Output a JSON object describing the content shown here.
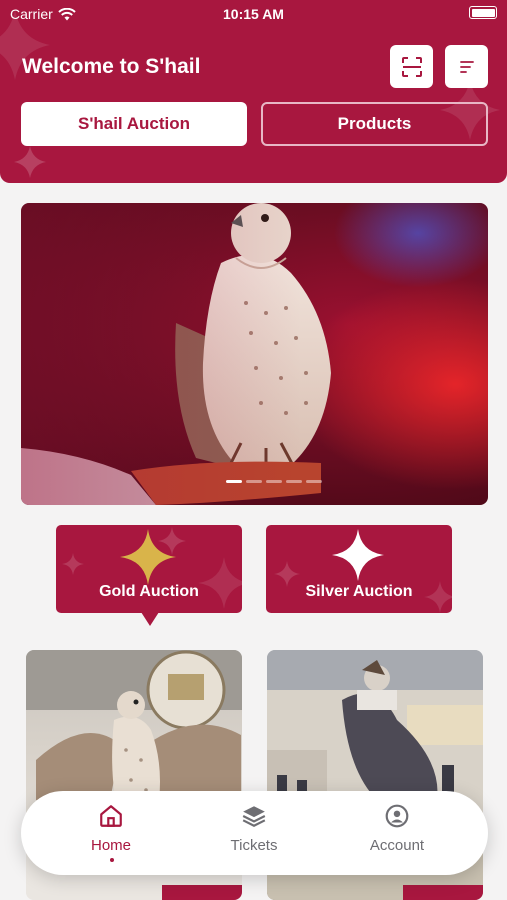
{
  "status_bar": {
    "carrier": "Carrier",
    "time": "10:15 AM"
  },
  "header": {
    "welcome": "Welcome to S'hail",
    "tabs": [
      {
        "label": "S'hail Auction",
        "active": true
      },
      {
        "label": "Products",
        "active": false
      }
    ]
  },
  "banner": {
    "slides": 5,
    "active_slide": 0
  },
  "auctions": [
    {
      "label": "Gold Auction",
      "selected": true,
      "star_color": "#d9b44a"
    },
    {
      "label": "Silver Auction",
      "selected": false,
      "star_color": "#ffffff"
    }
  ],
  "bottom_nav": {
    "items": [
      {
        "label": "Home",
        "icon": "home-icon",
        "active": true
      },
      {
        "label": "Tickets",
        "icon": "layers-icon",
        "active": false
      },
      {
        "label": "Account",
        "icon": "user-circle-icon",
        "active": false
      }
    ]
  },
  "colors": {
    "brand": "#a8173f",
    "gold": "#d9b44a",
    "background": "#f4f3f3"
  }
}
